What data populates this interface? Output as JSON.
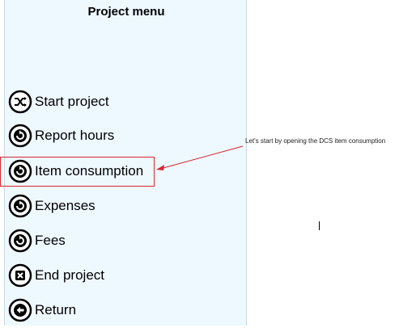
{
  "menu": {
    "title": "Project menu",
    "items": [
      {
        "id": "start-project",
        "label": "Start project",
        "icon": "shuffle-icon"
      },
      {
        "id": "report-hours",
        "label": "Report hours",
        "icon": "refresh-icon"
      },
      {
        "id": "item-consumption",
        "label": "Item consumption",
        "icon": "refresh-icon"
      },
      {
        "id": "expenses",
        "label": "Expenses",
        "icon": "refresh-icon"
      },
      {
        "id": "fees",
        "label": "Fees",
        "icon": "refresh-icon"
      },
      {
        "id": "end-project",
        "label": "End project",
        "icon": "close-icon"
      },
      {
        "id": "return",
        "label": "Return",
        "icon": "back-arrow-icon"
      }
    ]
  },
  "annotation": {
    "text": "Let's start by opening the DCS item consumption",
    "color": "#d7262e"
  },
  "colors": {
    "panel_background": "#eef8ff",
    "highlight": "#d7262e"
  }
}
